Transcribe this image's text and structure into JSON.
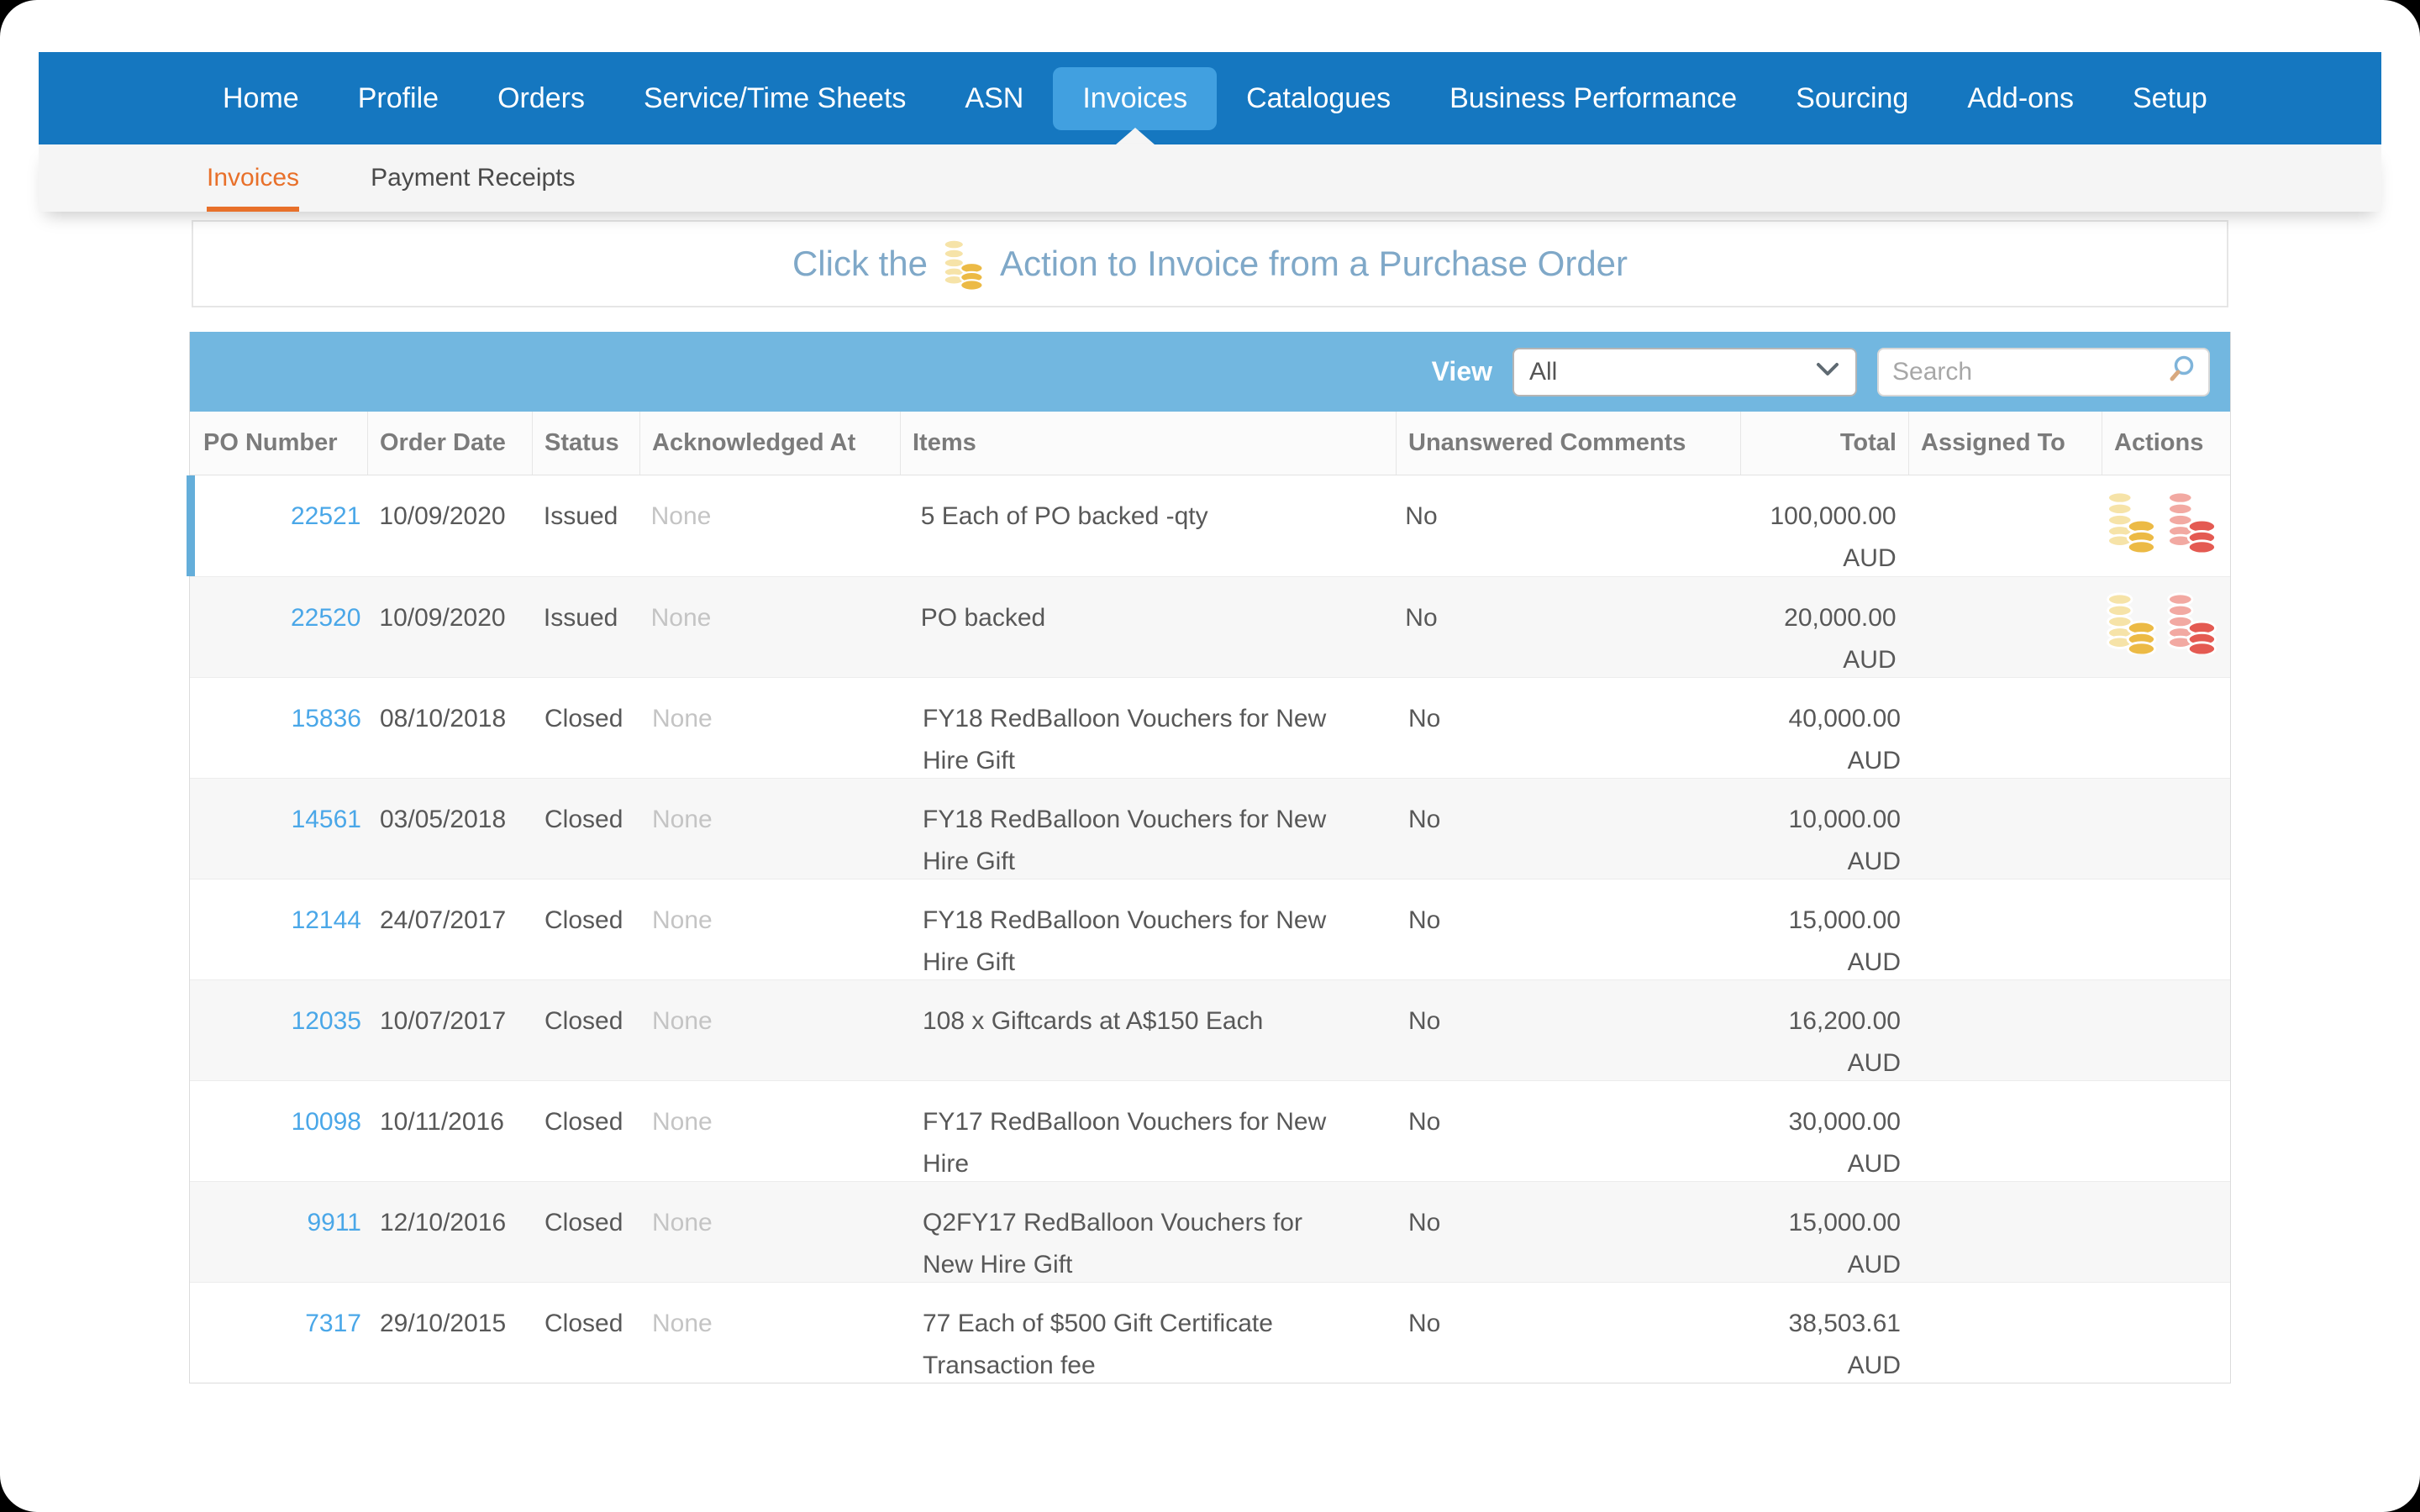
{
  "nav": {
    "items": [
      {
        "label": "Home",
        "active": false
      },
      {
        "label": "Profile",
        "active": false
      },
      {
        "label": "Orders",
        "active": false
      },
      {
        "label": "Service/Time Sheets",
        "active": false
      },
      {
        "label": "ASN",
        "active": false
      },
      {
        "label": "Invoices",
        "active": true
      },
      {
        "label": "Catalogues",
        "active": false
      },
      {
        "label": "Business Performance",
        "active": false
      },
      {
        "label": "Sourcing",
        "active": false
      },
      {
        "label": "Add-ons",
        "active": false
      },
      {
        "label": "Setup",
        "active": false
      }
    ]
  },
  "subnav": {
    "tabs": [
      {
        "label": "Invoices",
        "active": true
      },
      {
        "label": "Payment Receipts",
        "active": false
      }
    ]
  },
  "banner": {
    "text_before": "Click the",
    "icon": "gold-coins-icon",
    "text_after": "Action to Invoice from a Purchase Order"
  },
  "toolbar": {
    "view_label": "View",
    "view_value": "All",
    "search_placeholder": "Search",
    "dropdown_icon": "chevron-down-icon",
    "search_icon": "magnifier-icon"
  },
  "table": {
    "columns": [
      {
        "label": "PO Number"
      },
      {
        "label": "Order Date"
      },
      {
        "label": "Status"
      },
      {
        "label": "Acknowledged At"
      },
      {
        "label": "Items"
      },
      {
        "label": "Unanswered Comments"
      },
      {
        "label": "Total",
        "align": "right"
      },
      {
        "label": "Assigned To"
      },
      {
        "label": "Actions"
      }
    ],
    "rows": [
      {
        "po": "22521",
        "order_date": "10/09/2020",
        "status": "Issued",
        "acknowledged_at": "None",
        "items": "5 Each of PO backed -qty",
        "unanswered_comments": "No",
        "total": "100,000.00",
        "currency": "AUD",
        "assigned_to": "",
        "actions": [
          "create-invoice",
          "create-credit-note"
        ],
        "highlighted": true
      },
      {
        "po": "22520",
        "order_date": "10/09/2020",
        "status": "Issued",
        "acknowledged_at": "None",
        "items": "PO backed",
        "unanswered_comments": "No",
        "total": "20,000.00",
        "currency": "AUD",
        "assigned_to": "",
        "actions": [
          "create-invoice",
          "create-credit-note"
        ],
        "highlighted": false
      },
      {
        "po": "15836",
        "order_date": "08/10/2018",
        "status": "Closed",
        "acknowledged_at": "None",
        "items": "FY18 RedBalloon Vouchers for New Hire Gift",
        "unanswered_comments": "No",
        "total": "40,000.00",
        "currency": "AUD",
        "assigned_to": "",
        "actions": [],
        "highlighted": false
      },
      {
        "po": "14561",
        "order_date": "03/05/2018",
        "status": "Closed",
        "acknowledged_at": "None",
        "items": "FY18 RedBalloon Vouchers for New Hire Gift",
        "unanswered_comments": "No",
        "total": "10,000.00",
        "currency": "AUD",
        "assigned_to": "",
        "actions": [],
        "highlighted": false
      },
      {
        "po": "12144",
        "order_date": "24/07/2017",
        "status": "Closed",
        "acknowledged_at": "None",
        "items": "FY18 RedBalloon Vouchers for New Hire Gift",
        "unanswered_comments": "No",
        "total": "15,000.00",
        "currency": "AUD",
        "assigned_to": "",
        "actions": [],
        "highlighted": false
      },
      {
        "po": "12035",
        "order_date": "10/07/2017",
        "status": "Closed",
        "acknowledged_at": "None",
        "items": "108 x Giftcards at A$150 Each",
        "unanswered_comments": "No",
        "total": "16,200.00",
        "currency": "AUD",
        "assigned_to": "",
        "actions": [],
        "highlighted": false
      },
      {
        "po": "10098",
        "order_date": "10/11/2016",
        "status": "Closed",
        "acknowledged_at": "None",
        "items": "FY17 RedBalloon Vouchers for New Hire",
        "unanswered_comments": "No",
        "total": "30,000.00",
        "currency": "AUD",
        "assigned_to": "",
        "actions": [],
        "highlighted": false
      },
      {
        "po": "9911",
        "order_date": "12/10/2016",
        "status": "Closed",
        "acknowledged_at": "None",
        "items": "Q2FY17 RedBalloon Vouchers for New Hire Gift",
        "unanswered_comments": "No",
        "total": "15,000.00",
        "currency": "AUD",
        "assigned_to": "",
        "actions": [],
        "highlighted": false
      },
      {
        "po": "7317",
        "order_date": "29/10/2015",
        "status": "Closed",
        "acknowledged_at": "None",
        "items": "77 Each of $500 Gift Certificate Transaction fee",
        "unanswered_comments": "No",
        "total": "38,503.61",
        "currency": "AUD",
        "assigned_to": "",
        "actions": [],
        "highlighted": false
      }
    ]
  },
  "colors": {
    "nav_blue": "#1577c0",
    "active_tab_blue": "#41a0e0",
    "toolbar_blue": "#72b7e0",
    "banner_blue": "#7fa8c8",
    "link_blue": "#4aa7e8",
    "orange": "#e8702a",
    "coin_gold_light": "#f6e3a8",
    "coin_gold_dark": "#ecba45",
    "coin_red_light": "#f2a9a2",
    "coin_red_dark": "#e45a52"
  }
}
